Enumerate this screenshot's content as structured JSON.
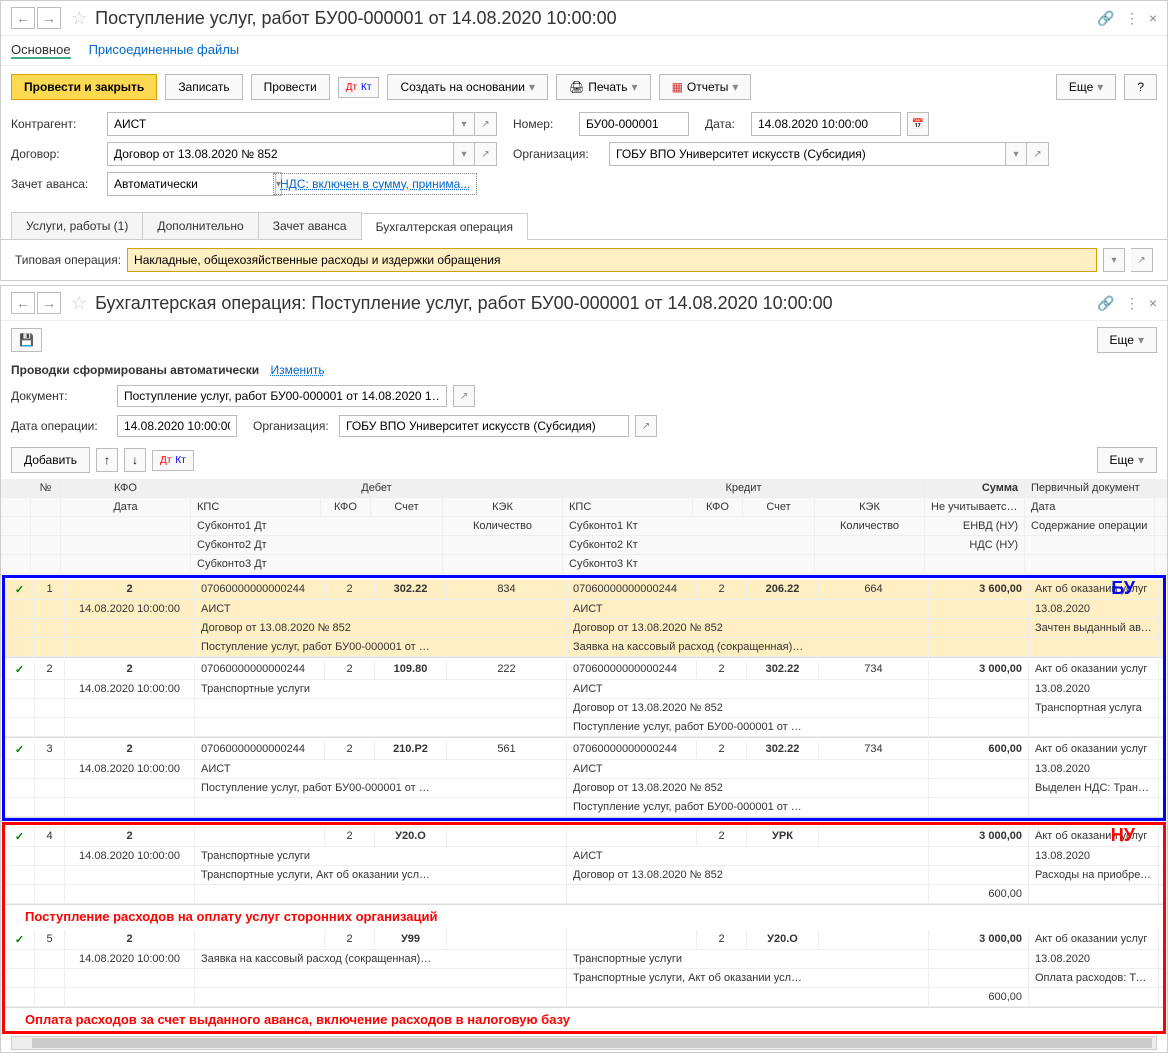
{
  "panel1": {
    "title": "Поступление услуг, работ БУ00-000001 от 14.08.2020 10:00:00",
    "nav": {
      "back": "←",
      "forward": "→",
      "star": "☆",
      "link": "🔗",
      "more": "⋮",
      "close": "×"
    },
    "topTabs": {
      "main": "Основное",
      "files": "Присоединенные файлы"
    },
    "toolbar": {
      "postClose": "Провести и закрыть",
      "write": "Записать",
      "post": "Провести",
      "createBased": "Создать на основании",
      "print": "Печать",
      "reports": "Отчеты",
      "more": "Еще",
      "help": "?"
    },
    "fields": {
      "counterpartyLabel": "Контрагент:",
      "counterparty": "АИСТ",
      "numberLabel": "Номер:",
      "number": "БУ00-000001",
      "dateLabel": "Дата:",
      "date": "14.08.2020 10:00:00",
      "contractLabel": "Договор:",
      "contract": "Договор от 13.08.2020 № 852",
      "orgLabel": "Организация:",
      "org": "ГОБУ ВПО Университет искусств (Субсидия)",
      "advanceLabel": "Зачет аванса:",
      "advance": "Автоматически",
      "vatLink": "НДС: включен в сумму, принима..."
    },
    "subTabs": {
      "services": "Услуги, работы (1)",
      "additional": "Дополнительно",
      "advance": "Зачет аванса",
      "accounting": "Бухгалтерская операция"
    },
    "typicalOp": {
      "label": "Типовая операция:",
      "value": "Накладные, общехозяйственные расходы и издержки обращения"
    }
  },
  "panel2": {
    "title": "Бухгалтерская операция: Поступление услуг, работ БУ00-000001 от 14.08.2020 10:00:00",
    "nav": {
      "back": "←",
      "forward": "→",
      "star": "☆",
      "link": "🔗",
      "more": "⋮",
      "close": "×"
    },
    "toolbar": {
      "more": "Еще"
    },
    "notice": {
      "text": "Проводки сформированы автоматически",
      "changeLink": "Изменить"
    },
    "fields": {
      "docLabel": "Документ:",
      "doc": "Поступление услуг, работ БУ00-000001 от 14.08.2020 1…",
      "dateLabel": "Дата операции:",
      "date": "14.08.2020 10:00:00",
      "orgLabel": "Организация:",
      "org": "ГОБУ ВПО Университет искусств (Субсидия)"
    },
    "gridToolbar": {
      "add": "Добавить",
      "up": "↑",
      "down": "↓",
      "more": "Еще"
    },
    "headers": {
      "n": "№",
      "kfo": "КФО",
      "date": "Дата",
      "debit": "Дебет",
      "credit": "Кредит",
      "kps": "КПС",
      "kfo2": "КФО",
      "sch": "Счет",
      "kek": "КЭК",
      "sum": "Сумма",
      "primDoc": "Первичный документ",
      "sub1d": "Субконто1 Дт",
      "sub2d": "Субконто2 Дт",
      "sub3d": "Субконто3 Дт",
      "sub1k": "Субконто1 Кт",
      "sub2k": "Субконто2 Кт",
      "sub3k": "Субконто3 Кт",
      "qty": "Количество",
      "notNu": "Не учитывается (НУ)",
      "envd": "ЕНВД (НУ)",
      "nds": "НДС (НУ)",
      "content": "Содержание операции"
    },
    "entries": [
      {
        "n": "1",
        "kfo": "2",
        "date": "14.08.2020 10:00:00",
        "dkps": "07060000000000244",
        "dkfo": "2",
        "dsch": "302.22",
        "dkek": "834",
        "kkps": "07060000000000244",
        "kkfo": "2",
        "ksch": "206.22",
        "kkek": "664",
        "sum": "3 600,00",
        "doc": "Акт об оказании услуг",
        "docDate": "13.08.2020",
        "sub1d": "АИСТ",
        "sub2d": "Договор от 13.08.2020 № 852",
        "sub3d": "Поступление услуг, работ БУ00-000001 от …",
        "sub1k": "АИСТ",
        "sub2k": "Договор от 13.08.2020 № 852",
        "sub3k": "Заявка на кассовый расход (сокращенная)…",
        "content": "Зачтен выданный аванс"
      },
      {
        "n": "2",
        "kfo": "2",
        "date": "14.08.2020 10:00:00",
        "dkps": "07060000000000244",
        "dkfo": "2",
        "dsch": "109.80",
        "dkek": "222",
        "kkps": "07060000000000244",
        "kkfo": "2",
        "ksch": "302.22",
        "kkek": "734",
        "sum": "3 000,00",
        "doc": "Акт об оказании услуг",
        "docDate": "13.08.2020",
        "sub1d": "Транспортные услуги",
        "sub2d": "",
        "sub3d": "",
        "sub1k": "АИСТ",
        "sub2k": "Договор от 13.08.2020 № 852",
        "sub3k": "Поступление услуг, работ БУ00-000001 от …",
        "content": "Транспортная услуга"
      },
      {
        "n": "3",
        "kfo": "2",
        "date": "14.08.2020 10:00:00",
        "dkps": "07060000000000244",
        "dkfo": "2",
        "dsch": "210.Р2",
        "dkek": "561",
        "kkps": "07060000000000244",
        "kkfo": "2",
        "ksch": "302.22",
        "kkek": "734",
        "sum": "600,00",
        "doc": "Акт об оказании услуг",
        "docDate": "13.08.2020",
        "sub1d": "АИСТ",
        "sub2d": "Поступление услуг, работ БУ00-000001 от …",
        "sub3d": "",
        "sub1k": "АИСТ",
        "sub2k": "Договор от 13.08.2020 № 852",
        "sub3k": "Поступление услуг, работ БУ00-000001 от …",
        "content": "Выделен НДС: Транспортная услуга"
      },
      {
        "n": "4",
        "kfo": "2",
        "date": "14.08.2020 10:00:00",
        "dkps": "",
        "dkfo": "2",
        "dsch": "У20.О",
        "dkek": "",
        "kkps": "",
        "kkfo": "2",
        "ksch": "УРК",
        "kkek": "",
        "sum": "3 000,00",
        "doc": "Акт об оказании услуг",
        "docDate": "13.08.2020",
        "sub1d": "Транспортные услуги",
        "sub2d": "Транспортные услуги, Акт об оказании усл…",
        "sub3d": "",
        "sub1k": "АИСТ",
        "sub2k": "Договор от 13.08.2020 № 852",
        "sub3k": "",
        "content": "Расходы на приобретение: Транспортные услуги, Ак…",
        "extraSum": "600,00"
      },
      {
        "n": "5",
        "kfo": "2",
        "date": "14.08.2020 10:00:00",
        "dkps": "",
        "dkfo": "2",
        "dsch": "У99",
        "dkek": "",
        "kkps": "",
        "kkfo": "2",
        "ksch": "У20.О",
        "kkek": "",
        "sum": "3 000,00",
        "doc": "Акт об оказании услуг",
        "docDate": "13.08.2020",
        "sub1d": "Заявка на кассовый расход (сокращенная)…",
        "sub2d": "",
        "sub3d": "",
        "sub1k": "Транспортные услуги",
        "sub2k": "Транспортные услуги, Акт об оказании усл…",
        "sub3k": "",
        "content": "Оплата расходов: Транспортные услуги, Ак…",
        "extraSum": "600,00"
      }
    ],
    "annotations": {
      "bu": "БУ",
      "nu": "НУ",
      "red1": "Поступление расходов на оплату услуг сторонних организаций",
      "red2": "Оплата расходов за счет выданного аванса, включение расходов в налоговую базу"
    }
  }
}
